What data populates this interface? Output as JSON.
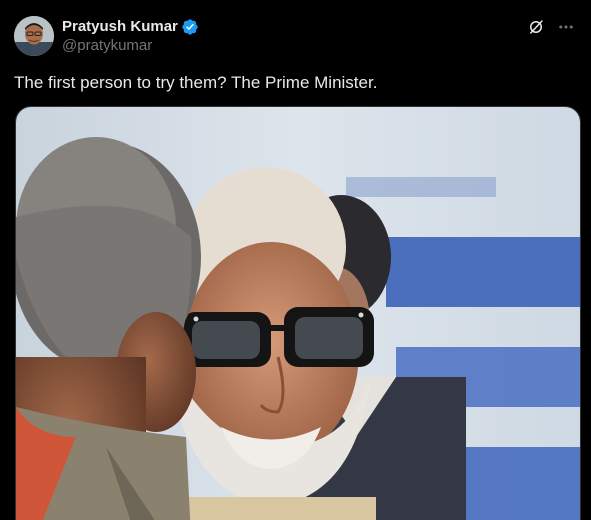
{
  "author": {
    "display_name": "Pratyush Kumar",
    "handle": "@pratykumar",
    "verified": true,
    "verified_color": "#1d9bf0",
    "avatar_icon": "user-avatar"
  },
  "header_actions": {
    "grok_icon": "grok-icon",
    "more_icon": "more-horizontal-icon"
  },
  "tweet": {
    "text": "The first person to try them? The Prime Minister."
  },
  "media": {
    "type": "photo"
  },
  "colors": {
    "background": "#000000",
    "text_primary": "#e7e9ea",
    "text_secondary": "#71767b",
    "accent": "#1d9bf0"
  }
}
